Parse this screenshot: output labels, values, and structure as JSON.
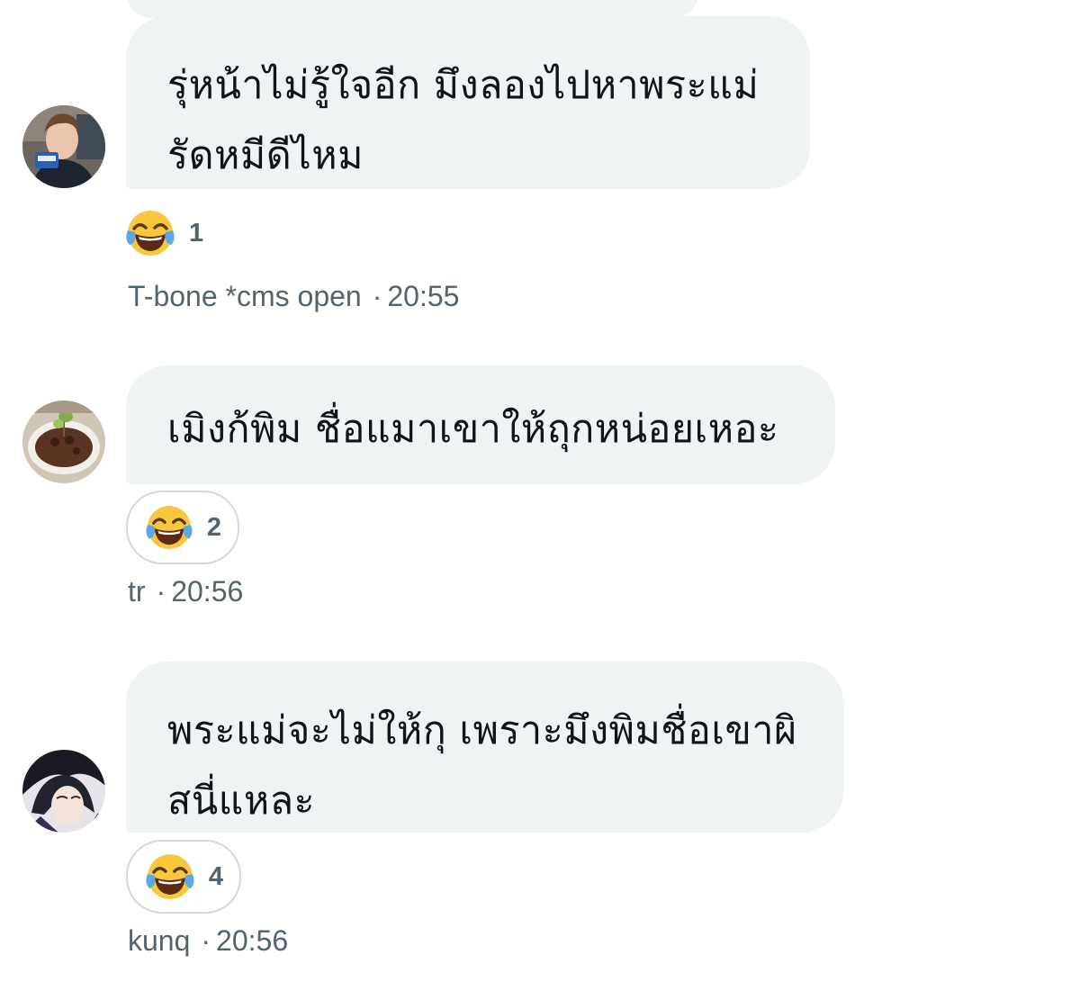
{
  "messages": [
    {
      "text_lines": [
        "รุ่หน้าไม่รู้ใจอีก มึงลองไปหาพระแม่",
        "รัดหมีดีไหม"
      ],
      "reaction": {
        "emoji": "face-with-tears-of-joy",
        "count": "1"
      },
      "sender": "T-bone *cms open",
      "separator": "·",
      "time": "20:55"
    },
    {
      "text_lines": [
        "เมิงก้พิม ชื่อแมาเขาให้ถุกหน่อยเหอะ"
      ],
      "reaction": {
        "emoji": "face-with-tears-of-joy",
        "count": "2"
      },
      "sender": "tr",
      "separator": "·",
      "time": "20:56"
    },
    {
      "text_lines": [
        "พระแม่จะไม่ให้กุ เพราะมึงพิมชื่อเขาผิ",
        "สนี่แหละ"
      ],
      "reaction": {
        "emoji": "face-with-tears-of-joy",
        "count": "4"
      },
      "sender": "kunq",
      "separator": "·",
      "time": "20:56"
    }
  ],
  "colors": {
    "bubble": "#eff3f4",
    "text": "#0f1419",
    "secondary_text": "#536471",
    "reaction_border": "#cfd9de"
  }
}
